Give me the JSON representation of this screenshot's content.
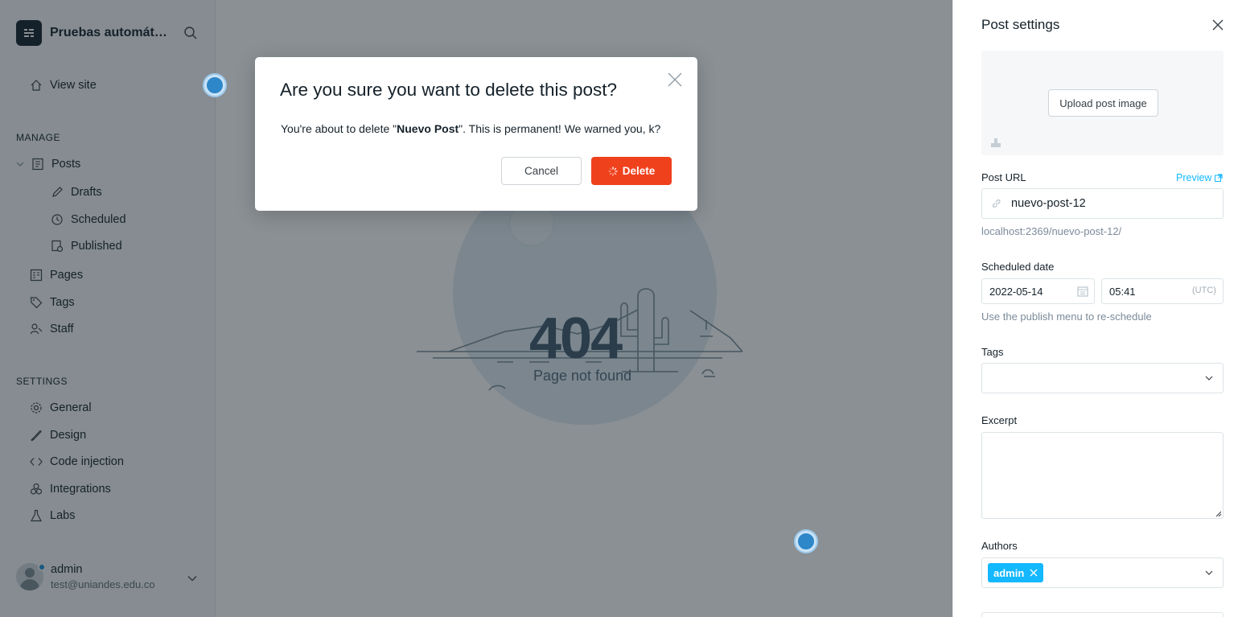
{
  "sidebar": {
    "site_title": "Pruebas automátic...",
    "view_site": "View site",
    "manage_heading": "MANAGE",
    "settings_heading": "SETTINGS",
    "manage_items": {
      "posts": "Posts",
      "drafts": "Drafts",
      "scheduled": "Scheduled",
      "published": "Published",
      "pages": "Pages",
      "tags": "Tags",
      "staff": "Staff"
    },
    "settings_items": {
      "general": "General",
      "design": "Design",
      "code_injection": "Code injection",
      "integrations": "Integrations",
      "labs": "Labs"
    },
    "user": {
      "name": "admin",
      "email": "test@uniandes.edu.co"
    }
  },
  "main": {
    "error_code": "404",
    "error_message": "Page not found"
  },
  "modal": {
    "title": "Are you sure you want to delete this post?",
    "body_prefix": "You're about to delete \"",
    "post_name": "Nuevo Post",
    "body_suffix": "\". This is permanent! We warned you, k?",
    "cancel_label": "Cancel",
    "delete_label": "Delete"
  },
  "settings_panel": {
    "title": "Post settings",
    "upload_label": "Upload post image",
    "post_url_label": "Post URL",
    "preview_label": "Preview",
    "slug_value": "nuevo-post-12",
    "full_url": "localhost:2369/nuevo-post-12/",
    "scheduled_date_label": "Scheduled date",
    "date_value": "2022-05-14",
    "time_value": "05:41",
    "timezone": "(UTC)",
    "schedule_help": "Use the publish menu to re-schedule",
    "tags_label": "Tags",
    "excerpt_label": "Excerpt",
    "authors_label": "Authors",
    "author_chip": "admin"
  },
  "colors": {
    "accent": "#14b8ff",
    "danger": "#f0411d",
    "dark": "#15212a"
  }
}
